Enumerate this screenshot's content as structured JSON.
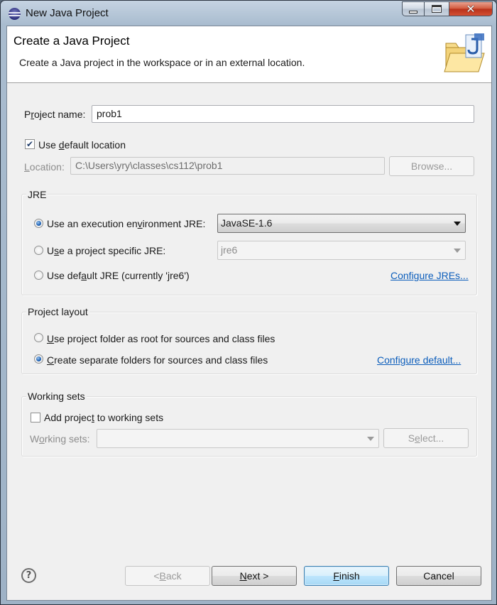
{
  "window": {
    "title": "New Java Project",
    "icon": "eclipse-icon",
    "controls": {
      "minimize": "minimize-icon",
      "maximize": "maximize-icon",
      "close": "close-icon"
    }
  },
  "banner": {
    "title": "Create a Java Project",
    "description": "Create a Java project in the workspace or in an external location.",
    "icon": "java-project-folder-icon"
  },
  "project": {
    "name_label_pre": "P",
    "name_label_mn": "r",
    "name_label_post": "oject name:",
    "name_value": "prob1",
    "use_default_pre": "Use ",
    "use_default_mn": "d",
    "use_default_post": "efault location",
    "use_default_checked": true,
    "location_label_mn": "L",
    "location_label_post": "ocation:",
    "location_value": "C:\\Users\\yry\\classes\\cs112\\prob1",
    "browse_label": "Browse..."
  },
  "jre": {
    "group_title": "JRE",
    "option1_pre": "Use an execution en",
    "option1_mn": "v",
    "option1_post": "ironment JRE:",
    "option1_value": "JavaSE-1.6",
    "option2_pre": "U",
    "option2_mn": "s",
    "option2_post": "e a project specific JRE:",
    "option2_value": "jre6",
    "option3_pre": "Use def",
    "option3_mn": "a",
    "option3_post": "ult JRE (currently 'jre6')",
    "configure_link": "Configure JREs...",
    "selected": 1
  },
  "layout": {
    "group_title": "Project layout",
    "option1_pre": "",
    "option1_mn": "U",
    "option1_post": "se project folder as root for sources and class files",
    "option2_pre": "",
    "option2_mn": "C",
    "option2_post": "reate separate folders for sources and class files",
    "configure_link": "Configure default...",
    "selected": 2
  },
  "working_sets": {
    "group_title": "Working sets",
    "add_pre": "Add projec",
    "add_mn": "t",
    "add_post": " to working sets",
    "add_checked": false,
    "label_pre": "W",
    "label_mn": "o",
    "label_post": "rking sets:",
    "select_pre": "S",
    "select_mn": "e",
    "select_post": "lect..."
  },
  "footer": {
    "help_icon": "help-icon",
    "back_pre": "< ",
    "back_mn": "B",
    "back_post": "ack",
    "next_mn": "N",
    "next_post": "ext >",
    "finish_mn": "F",
    "finish_post": "inish",
    "cancel_label": "Cancel"
  }
}
